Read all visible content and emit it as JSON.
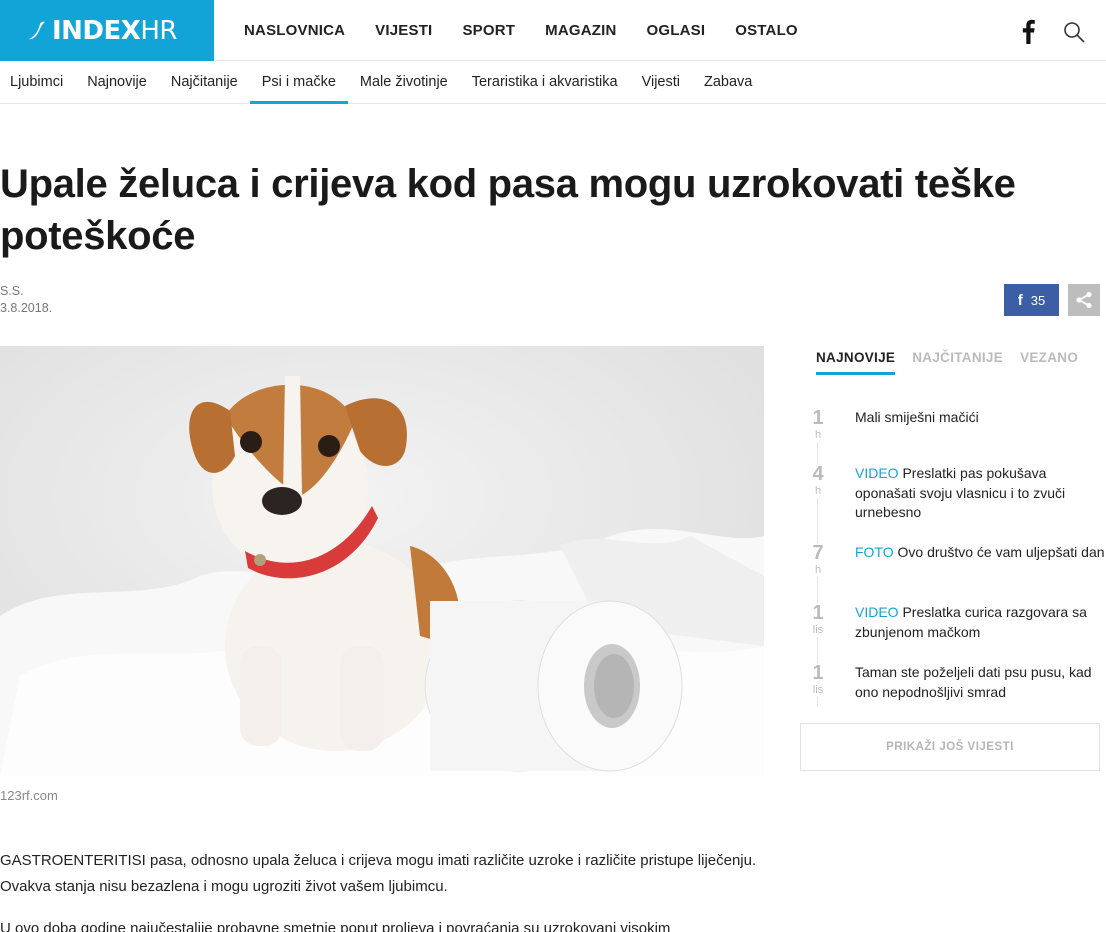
{
  "header": {
    "logo_main": "INDEX",
    "logo_suffix": "HR",
    "nav": [
      "NASLOVNICA",
      "VIJESTI",
      "SPORT",
      "MAGAZIN",
      "OGLASI",
      "OSTALO"
    ]
  },
  "subnav": {
    "items": [
      "Ljubimci",
      "Najnovije",
      "Najčitanije",
      "Psi i mačke",
      "Male životinje",
      "Teraristika i akvaristika",
      "Vijesti",
      "Zabava"
    ],
    "active": "Psi i mačke"
  },
  "article": {
    "title": "Upale želuca i crijeva kod pasa mogu uzrokovati teške poteškoće",
    "author": "S.S.",
    "date": "3.8.2018.",
    "fb_share_count": "35",
    "image_caption": "123rf.com",
    "paragraphs": [
      "GASTROENTERITISI pasa, odnosno upala želuca i crijeva mogu imati različite uzroke i različite pristupe liječenju. Ovakva stanja nisu bezazlena i mogu ugroziti život vašem ljubimcu.",
      "U ovo doba godine najučestalije probavne smetnje poput proljeva i povraćanja su uzrokovani visokim"
    ]
  },
  "sidebar": {
    "tabs": [
      "NAJNOVIJE",
      "NAJČITANIJE",
      "VEZANO"
    ],
    "active_tab": "NAJNOVIJE",
    "items": [
      {
        "num": "1",
        "unit": "h",
        "tag": "",
        "text": "Mali smiješni mačići"
      },
      {
        "num": "4",
        "unit": "h",
        "tag": "VIDEO",
        "text": "Preslatki pas pokušava oponašati svoju vlasnicu i to zvuči urnebesno"
      },
      {
        "num": "7",
        "unit": "h",
        "tag": "FOTO",
        "text": "Ovo društvo će vam uljepšati dan"
      },
      {
        "num": "1",
        "unit": "lis",
        "tag": "VIDEO",
        "text": "Preslatka curica razgovara sa zbunjenom mačkom"
      },
      {
        "num": "1",
        "unit": "lis",
        "tag": "",
        "text": "Taman ste poželjeli dati psu pusu, kad ono nepodnošljivi smrad"
      }
    ],
    "more_button": "PRIKAŽI JOŠ VIJESTI"
  },
  "colors": {
    "brand": "#12a4d6",
    "facebook": "#3b5ea7"
  }
}
